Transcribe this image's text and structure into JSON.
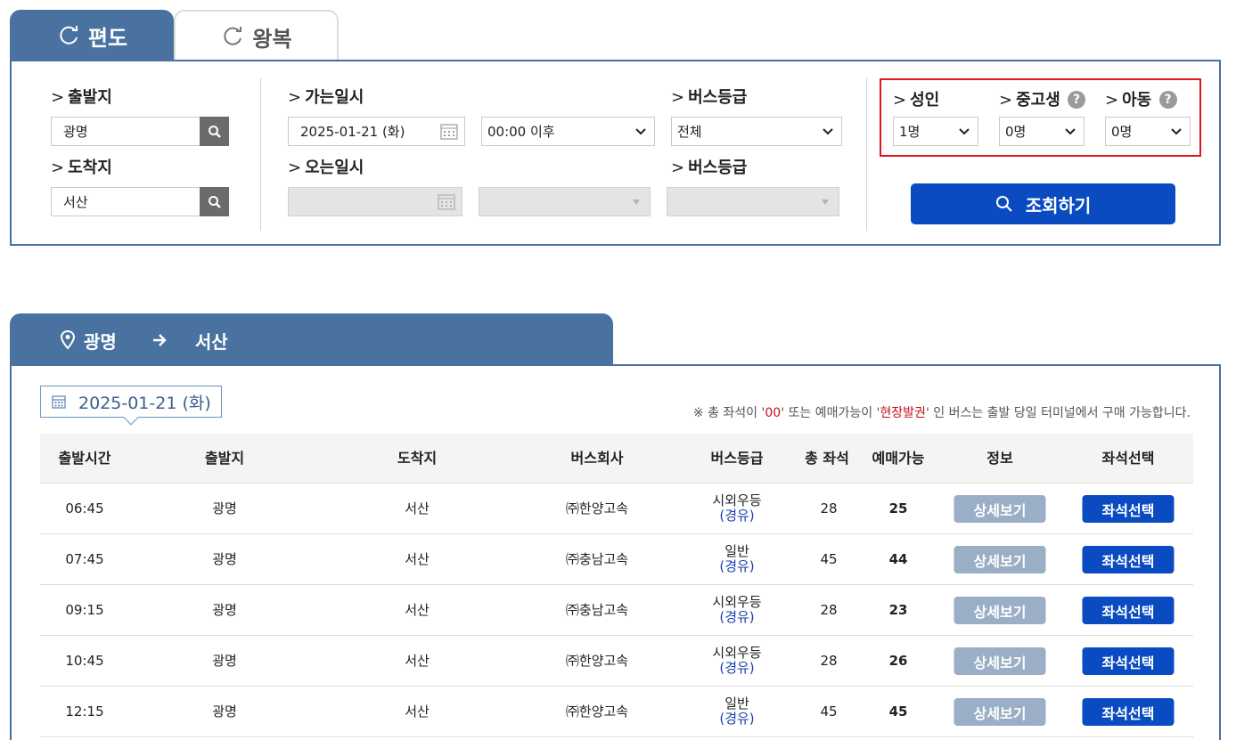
{
  "tabs": [
    {
      "label": "편도",
      "icon": "refresh-icon",
      "active": true
    },
    {
      "label": "왕복",
      "icon": "refresh-icon",
      "active": false
    }
  ],
  "search": {
    "departure_label": "출발지",
    "departure_value": "광명",
    "arrival_label": "도착지",
    "arrival_value": "서산",
    "go_date_label": "가는일시",
    "go_date_value": "2025-01-21 (화)",
    "go_time_value": "00:00 이후",
    "bus_grade_label": "버스등급",
    "bus_grade_value": "전체",
    "return_date_label": "오는일시",
    "return_bus_grade_label": "버스등급",
    "adult_label": "성인",
    "adult_value": "1명",
    "student_label": "중고생",
    "student_value": "0명",
    "child_label": "아동",
    "child_value": "0명",
    "help_glyph": "?",
    "query_button": "조회하기"
  },
  "route": {
    "from": "광명",
    "to": "서산"
  },
  "results": {
    "date": "2025-01-21 (화)",
    "notice_prefix": "※ 총 좌석이 '",
    "notice_zero": "00",
    "notice_middle": "' 또는 예매가능이 '",
    "notice_onsite": "현장발권",
    "notice_suffix": "' 인 버스는 출발 당일 터미널에서 구매 가능합니다.",
    "columns": [
      "출발시간",
      "출발지",
      "도착지",
      "버스회사",
      "버스등급",
      "총 좌석",
      "예매가능",
      "정보",
      "좌석선택"
    ],
    "detail_button": "상세보기",
    "seat_button": "좌석선택",
    "rows": [
      {
        "time": "06:45",
        "from": "광명",
        "to": "서산",
        "company": "㈜한양고속",
        "grade": "시외우등",
        "via": "(경유)",
        "total": "28",
        "available": "25"
      },
      {
        "time": "07:45",
        "from": "광명",
        "to": "서산",
        "company": "㈜충남고속",
        "grade": "일반",
        "via": "(경유)",
        "total": "45",
        "available": "44"
      },
      {
        "time": "09:15",
        "from": "광명",
        "to": "서산",
        "company": "㈜충남고속",
        "grade": "시외우등",
        "via": "(경유)",
        "total": "28",
        "available": "23"
      },
      {
        "time": "10:45",
        "from": "광명",
        "to": "서산",
        "company": "㈜한양고속",
        "grade": "시외우등",
        "via": "(경유)",
        "total": "28",
        "available": "26"
      },
      {
        "time": "12:15",
        "from": "광명",
        "to": "서산",
        "company": "㈜한양고속",
        "grade": "일반",
        "via": "(경유)",
        "total": "45",
        "available": "45"
      }
    ]
  },
  "colors": {
    "primary_blue": "#4a72a0",
    "button_blue": "#0a4bc2",
    "detail_button": "#9aaec5",
    "highlight_red": "#e0161b",
    "notice_red": "#c4101c"
  }
}
